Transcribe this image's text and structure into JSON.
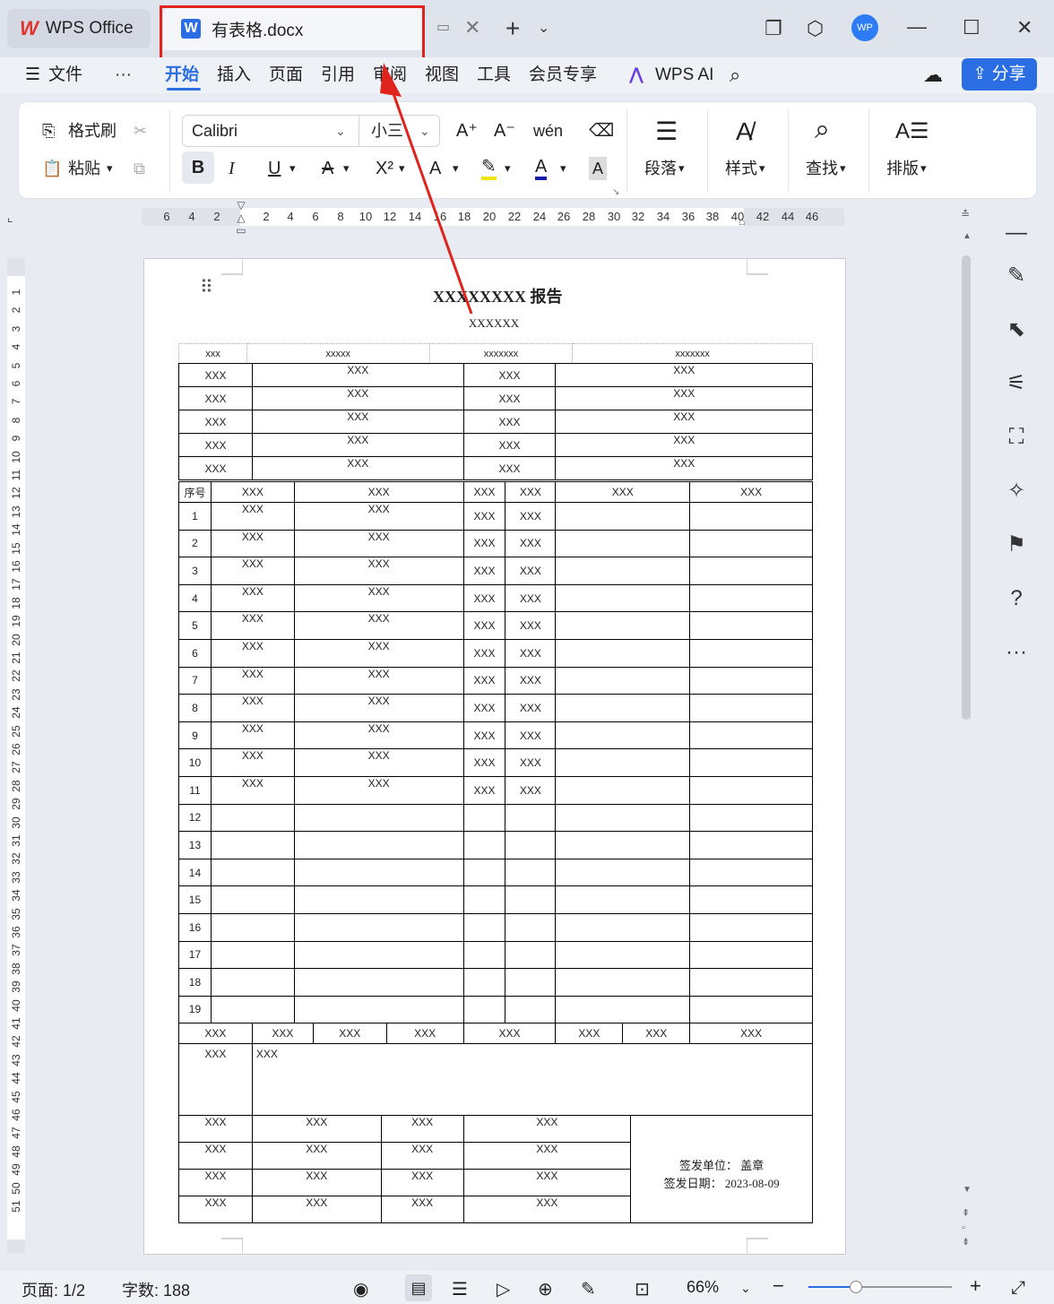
{
  "titlebar": {
    "app_name": "WPS Office",
    "doc_tab": "有表格.docx",
    "avatar": "WP"
  },
  "menu": {
    "file": "文件",
    "more": "···",
    "tabs": [
      "开始",
      "插入",
      "页面",
      "引用",
      "审阅",
      "视图",
      "工具",
      "会员专享"
    ],
    "wps_ai": "WPS AI",
    "share": "分享"
  },
  "ribbon": {
    "format_painter": "格式刷",
    "paste": "粘贴",
    "font_name": "Calibri",
    "font_size": "小三",
    "paragraph": "段落",
    "style": "样式",
    "find": "查找",
    "layout": "排版",
    "bold": "B",
    "italic": "I",
    "underline": "U"
  },
  "ruler": {
    "h_marks": [
      "6",
      "4",
      "2",
      "2",
      "4",
      "6",
      "8",
      "10",
      "12",
      "14",
      "16",
      "18",
      "20",
      "22",
      "24",
      "26",
      "28",
      "30",
      "32",
      "34",
      "36",
      "38",
      "40",
      "42",
      "44",
      "46"
    ],
    "v_marks": [
      "1",
      "2",
      "3",
      "4",
      "5",
      "6",
      "7",
      "8",
      "9",
      "10",
      "11",
      "12",
      "13",
      "14",
      "15",
      "16",
      "17",
      "18",
      "19",
      "20",
      "21",
      "22",
      "23",
      "24",
      "25",
      "26",
      "27",
      "28",
      "29",
      "30",
      "31",
      "32",
      "33",
      "34",
      "35",
      "36",
      "37",
      "38",
      "39",
      "40",
      "41",
      "42",
      "43",
      "44",
      "45",
      "46",
      "47",
      "48",
      "49",
      "50",
      "51"
    ]
  },
  "document": {
    "title": "XXXXXXXX 报告",
    "subtitle": "XXXXXX",
    "header_row": [
      "xxx",
      "xxxxx",
      "xxxxxxx",
      "xxxxxxx"
    ],
    "info_rows": [
      [
        "XXX",
        "XXX",
        "XXX",
        "XXX"
      ],
      [
        "XXX",
        "XXX",
        "XXX",
        "XXX"
      ],
      [
        "XXX",
        "XXX",
        "XXX",
        "XXX"
      ],
      [
        "XXX",
        "XXX",
        "XXX",
        "XXX"
      ],
      [
        "XXX",
        "XXX",
        "XXX",
        "XXX"
      ]
    ],
    "list_header": [
      "序号",
      "XXX",
      "XXX",
      "XXX",
      "XXX",
      "XXX",
      "XXX"
    ],
    "list_rows_filled": 11,
    "list_rows_total": 19,
    "cell_text": "XXX",
    "summary_row": [
      "XXX",
      "XXX",
      "XXX",
      "XXX",
      "XXX",
      "XXX",
      "XXX",
      "XXX"
    ],
    "remark_label": "XXX",
    "remark_text": "XXX",
    "footer_rows": [
      [
        "XXX",
        "XXX",
        "XXX",
        "XXX"
      ],
      [
        "XXX",
        "XXX",
        "XXX",
        "XXX"
      ],
      [
        "XXX",
        "XXX",
        "XXX",
        "XXX"
      ],
      [
        "XXX",
        "XXX",
        "XXX",
        "XXX"
      ]
    ],
    "issuer_label": "签发单位：",
    "issuer_value": "盖章",
    "date_label": "签发日期：",
    "date_value": "2023-08-09"
  },
  "status": {
    "page": "页面: 1/2",
    "words": "字数: 188",
    "zoom": "66%"
  },
  "colors": {
    "accent": "#2b6de3",
    "annotation": "#e0231c"
  }
}
